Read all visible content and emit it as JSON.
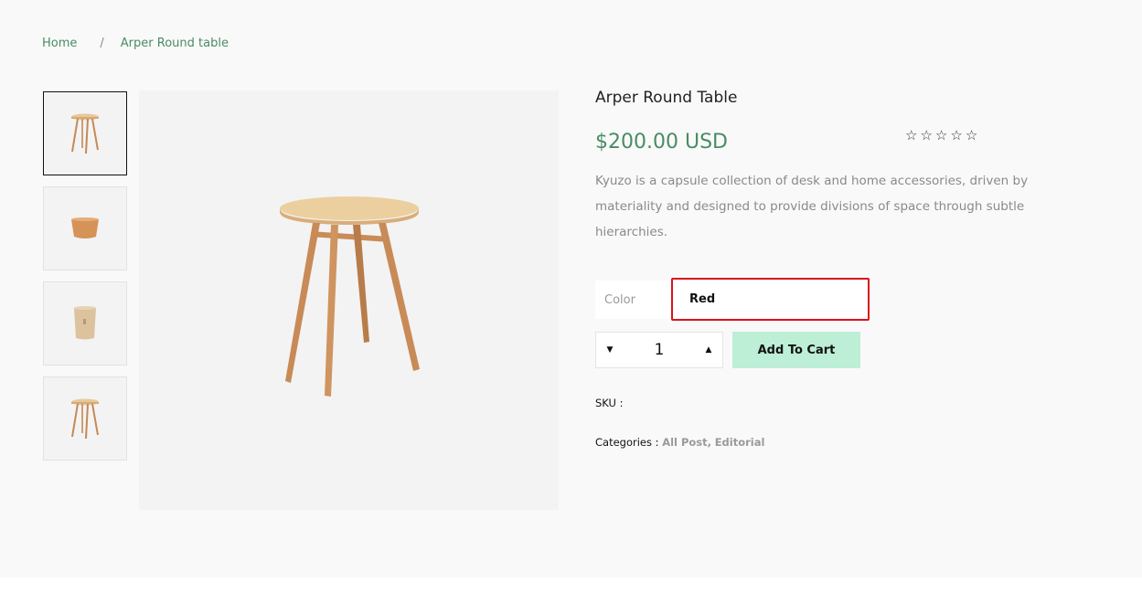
{
  "breadcrumb": {
    "home": "Home",
    "separator": "/",
    "current": "Arper Round table"
  },
  "product": {
    "title": "Arper Round Table",
    "price": "$200.00 USD",
    "rating": 0,
    "rating_max": 5,
    "description": "Kyuzo is a capsule collection of desk and home accessories, driven by materiality and designed to provide divisions of space through subtle hierarchies.",
    "color_label": "Color",
    "color_value": "Red",
    "quantity": "1",
    "add_to_cart": "Add To Cart",
    "sku_label": "SKU :",
    "categories_label": "Categories :",
    "categories": [
      "All Post",
      "Editorial"
    ],
    "category_separator": ","
  },
  "icons": {
    "star": "☆",
    "qty_down": "▼",
    "qty_up": "▲"
  },
  "colors": {
    "accent": "#4a8c64",
    "cart_button": "#bdeed6",
    "highlight": "#d9121b"
  }
}
